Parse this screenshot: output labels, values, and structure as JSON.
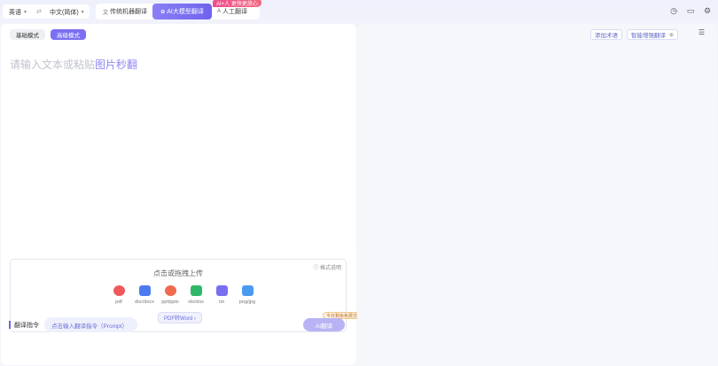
{
  "lang": {
    "source": "英语",
    "target": "中文(简体)",
    "swap_icon": "⇄"
  },
  "modes": [
    {
      "label": "传统机器翻译",
      "icon": "文"
    },
    {
      "label": "AI大模型翻译",
      "icon": "✿"
    },
    {
      "label": "人工翻译",
      "icon": "A"
    }
  ],
  "mode_badge": "AI+人 更快更放心",
  "top_icons": [
    "history-icon",
    "folder-icon",
    "settings-icon"
  ],
  "subtabs": {
    "basic": "基础模式",
    "advanced": "高级模式"
  },
  "right_tools": {
    "add_term": "添加术语",
    "smart_enhance": "智能增强翻译"
  },
  "placeholder": {
    "text": "请输入文本或粘贴",
    "link": "图片秒翻"
  },
  "upload": {
    "title": "点击或拖拽上传",
    "format_help": "格式说明",
    "filetypes": [
      {
        "label": "pdf",
        "color": "#f0595a"
      },
      {
        "label": "doc/docx",
        "color": "#4d7cf0"
      },
      {
        "label": "ppt/pptx",
        "color": "#f06a4d"
      },
      {
        "label": "xls/xlsx",
        "color": "#2fb86b"
      },
      {
        "label": "txt",
        "color": "#7a6ff0"
      },
      {
        "label": "png/jpg",
        "color": "#4a9af0"
      }
    ],
    "pdf2word": "PDF转Word ›"
  },
  "prompt": {
    "label": "翻译指令",
    "input_placeholder": "点击输入翻译指令（Prompt）"
  },
  "ai_button": "AI翻译",
  "free_badge": "今日剩余免费次数 3"
}
